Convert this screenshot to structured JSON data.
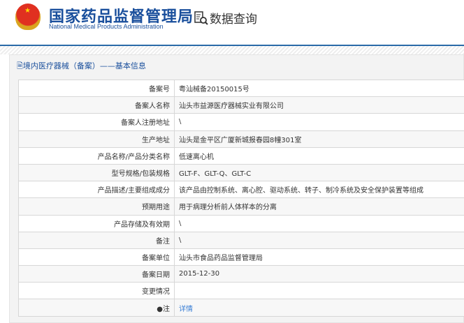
{
  "header": {
    "org_cn": "国家药品监督管理局",
    "org_en": "National Medical Products Administration",
    "query": "数据查询"
  },
  "panel": {
    "title": "境内医疗器械（备案）——基本信息"
  },
  "rows": [
    {
      "label": "备案号",
      "value": "粤汕械备20150015号"
    },
    {
      "label": "备案人名称",
      "value": "汕头市益源医疗器械实业有限公司"
    },
    {
      "label": "备案人注册地址",
      "value": "\\"
    },
    {
      "label": "生产地址",
      "value": "汕头是金平区广厦新城报春园8幢301室"
    },
    {
      "label": "产品名称/产品分类名称",
      "value": "低速离心机"
    },
    {
      "label": "型号规格/包装规格",
      "value": "GLT-F、GLT-Q、GLT-C"
    },
    {
      "label": "产品描述/主要组成成分",
      "value": "该产品由控制系统、离心腔、驱动系统、转子、制冷系统及安全保护装置等组成"
    },
    {
      "label": "预期用途",
      "value": "用于病理分析前人体样本的分离"
    },
    {
      "label": "产品存储及有效期",
      "value": "\\"
    },
    {
      "label": "备注",
      "value": "\\"
    },
    {
      "label": "备案单位",
      "value": "汕头市食品药品监督管理局"
    },
    {
      "label": "备案日期",
      "value": "2015-12-30"
    },
    {
      "label": "变更情况",
      "value": ""
    }
  ],
  "note": {
    "label": "注",
    "link": "详情"
  }
}
